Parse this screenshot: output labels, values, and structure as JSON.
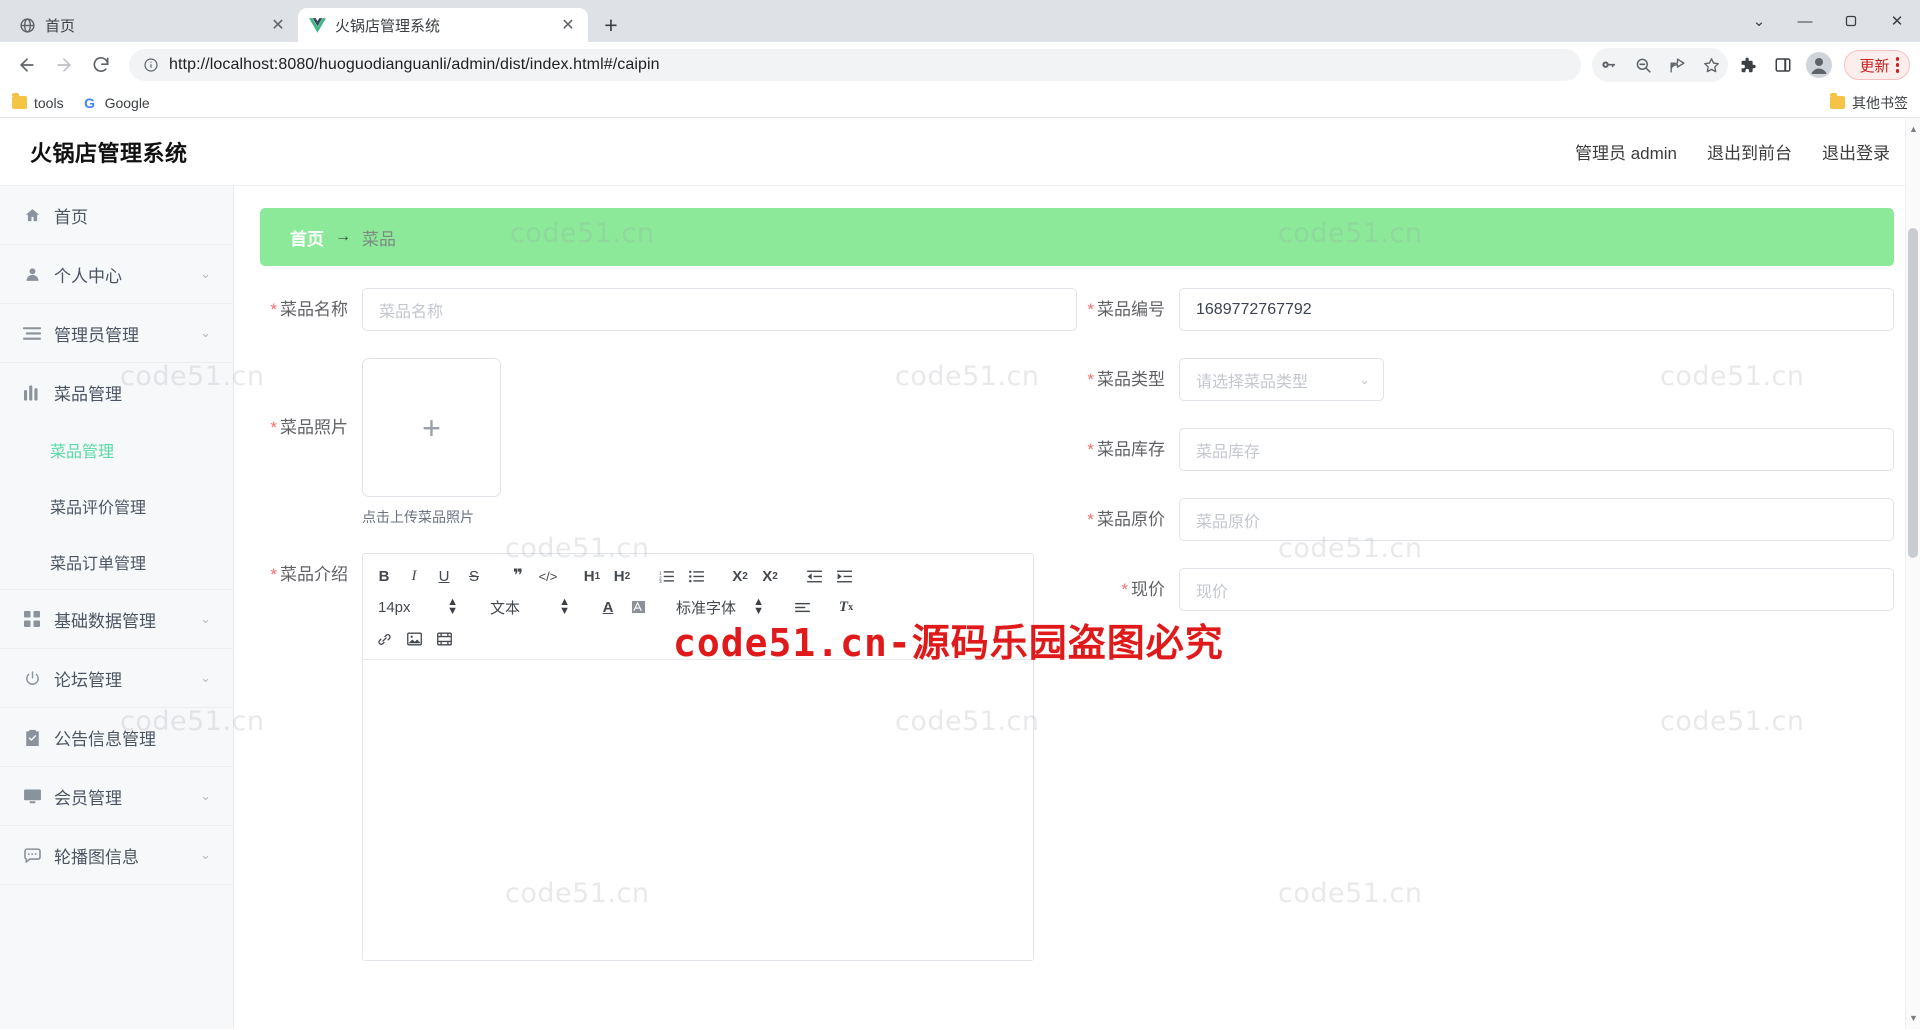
{
  "browser": {
    "tabs": [
      {
        "title": "首页",
        "favicon": "globe-icon",
        "active": false
      },
      {
        "title": "火锅店管理系统",
        "favicon": "vue-icon",
        "active": true
      }
    ],
    "new_tab_label": "+",
    "window_controls": {
      "minimize": "—",
      "maximize": "▫",
      "close": "✕",
      "more": "⌄"
    },
    "nav": {
      "back": "←",
      "forward": "→",
      "reload": "⟳"
    },
    "omnibox": {
      "info_icon": "info-circle-icon",
      "scheme": "http://",
      "url_rest": "localhost:8080/huoguodianguanli/admin/dist/index.html#/caipin",
      "full_url": "http://localhost:8080/huoguodianguanli/admin/dist/index.html#/caipin"
    },
    "toolbar_icons": [
      "key-icon",
      "zoom-out-icon",
      "share-icon",
      "star-icon",
      "extensions-icon",
      "side-panel-icon",
      "profile-icon"
    ],
    "update_button": "更新",
    "bookmarks": [
      {
        "label": "tools",
        "icon": "folder-icon"
      },
      {
        "label": "Google",
        "icon": "google-icon"
      }
    ],
    "other_bookmarks": "其他书签"
  },
  "app": {
    "logo": "火锅店管理系统",
    "header_links": [
      "管理员 admin",
      "退出到前台",
      "退出登录"
    ],
    "sidebar": [
      {
        "label": "首页",
        "icon": "home-icon",
        "caret": false
      },
      {
        "label": "个人中心",
        "icon": "user-icon",
        "caret": true
      },
      {
        "label": "管理员管理",
        "icon": "list-icon",
        "caret": true
      },
      {
        "label": "菜品管理",
        "icon": "bar-chart-icon",
        "caret": false
      }
    ],
    "sidebar_sub": [
      {
        "label": "菜品管理",
        "active": true
      },
      {
        "label": "菜品评价管理",
        "active": false
      },
      {
        "label": "菜品订单管理",
        "active": false
      }
    ],
    "sidebar_rest": [
      {
        "label": "基础数据管理",
        "icon": "grid-icon",
        "caret": true
      },
      {
        "label": "论坛管理",
        "icon": "power-icon",
        "caret": true
      },
      {
        "label": "公告信息管理",
        "icon": "clipboard-check-icon",
        "caret": false
      },
      {
        "label": "会员管理",
        "icon": "monitor-icon",
        "caret": true
      },
      {
        "label": "轮播图信息",
        "icon": "chat-icon",
        "caret": true
      }
    ],
    "breadcrumb": {
      "home": "首页",
      "arrow": "→",
      "current": "菜品"
    },
    "form": {
      "name": {
        "label": "菜品名称",
        "placeholder": "菜品名称",
        "value": "",
        "required": true
      },
      "photo": {
        "label": "菜品照片",
        "plus": "+",
        "hint": "点击上传菜品照片",
        "required": true
      },
      "intro": {
        "label": "菜品介绍",
        "required": true
      },
      "code": {
        "label": "菜品编号",
        "placeholder": "",
        "value": "1689772767792",
        "required": true
      },
      "type": {
        "label": "菜品类型",
        "placeholder": "请选择菜品类型",
        "value": "",
        "required": true,
        "caret": "chevron-down-icon"
      },
      "stock": {
        "label": "菜品库存",
        "placeholder": "菜品库存",
        "value": "",
        "required": true
      },
      "original_price": {
        "label": "菜品原价",
        "placeholder": "菜品原价",
        "value": "",
        "required": true
      },
      "price": {
        "label": "现价",
        "placeholder": "现价",
        "value": "",
        "required": true
      }
    },
    "editor": {
      "row1": [
        "B",
        "I",
        "U",
        "S",
        "❞",
        "</>",
        "H₁",
        "H₂",
        "ordered-list-icon",
        "bullet-list-icon",
        "X₂",
        "X²",
        "outdent-icon",
        "indent-icon"
      ],
      "font_size": "14px",
      "text_style": "文本",
      "color_icon": "A",
      "highlight_icon": "highlight-icon",
      "font_family": "标准字体",
      "align_icon": "align-icon",
      "clear_icon": "Tx",
      "row3": [
        "link-icon",
        "image-icon",
        "video-icon"
      ]
    }
  },
  "watermarks": {
    "text": "code51.cn",
    "red_text": "code51.cn-源码乐园盗图必究"
  }
}
